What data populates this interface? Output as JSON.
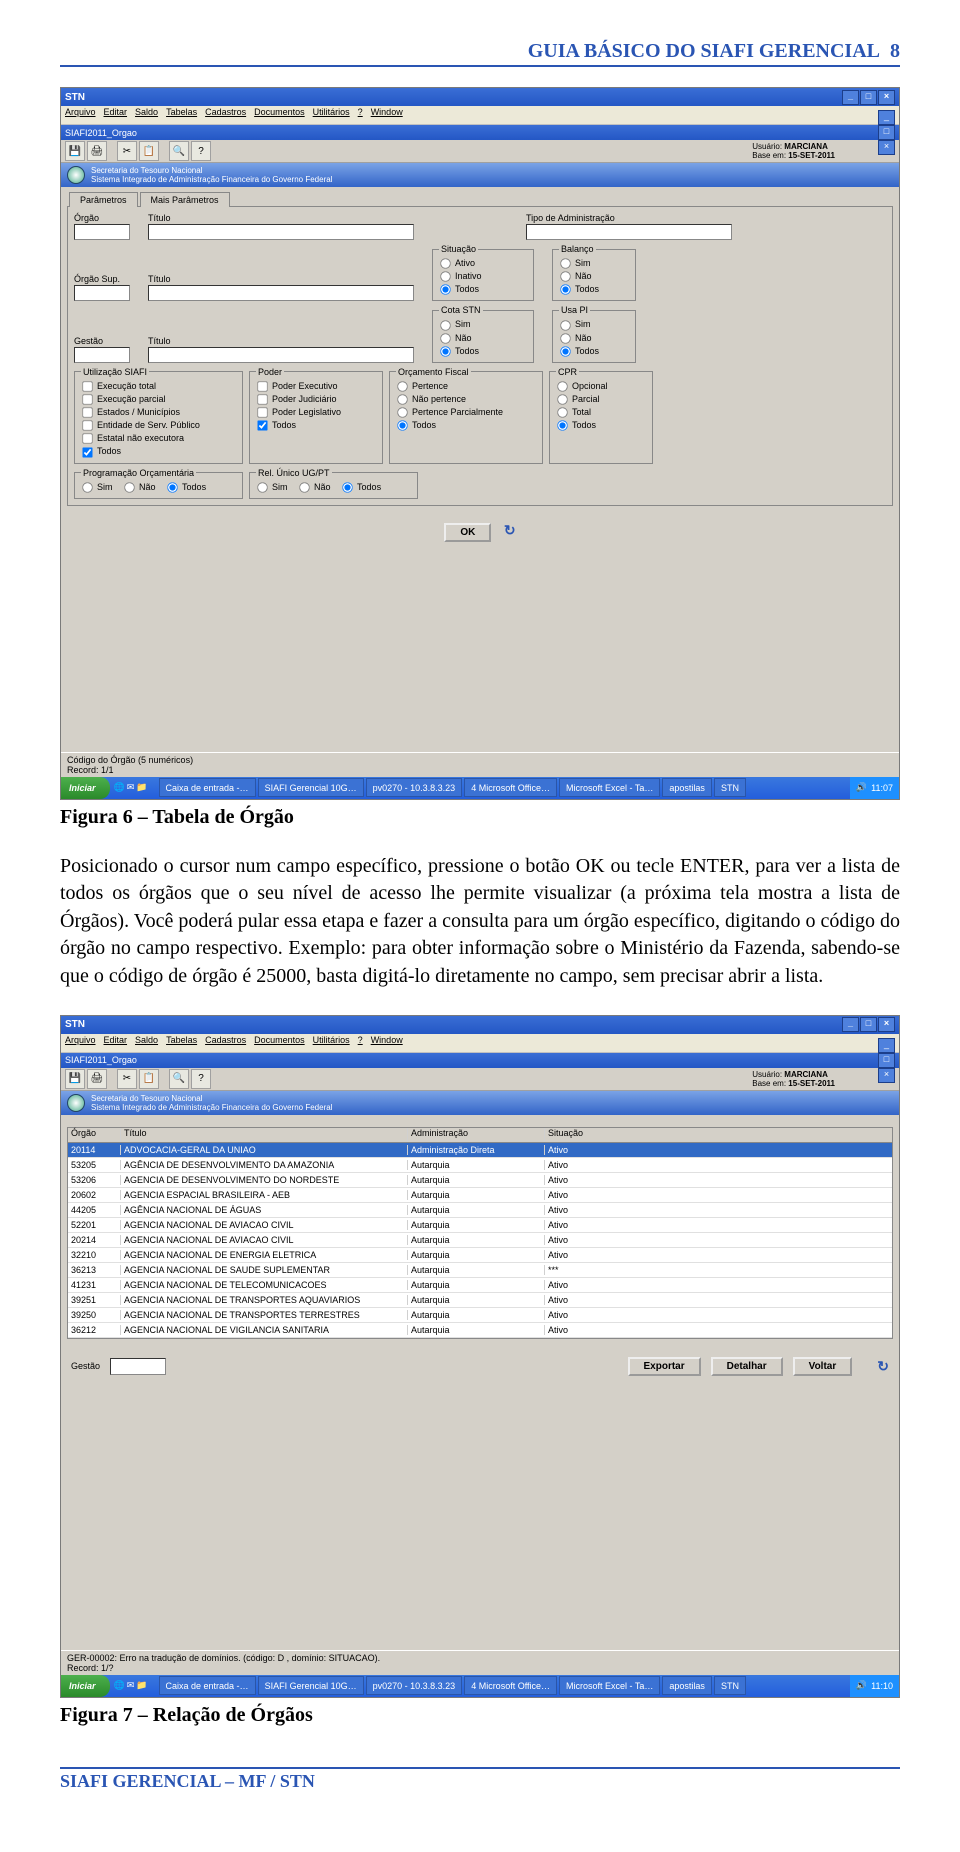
{
  "page": {
    "header": "GUIA BÁSICO DO SIAFI GERENCIAL",
    "page_number": "8",
    "footer": "SIAFI GERENCIAL – MF / STN"
  },
  "fig1": {
    "caption": "Figura 6 – Tabela de Órgão",
    "window_title": "STN",
    "menu": [
      "Arquivo",
      "Editar",
      "Saldo",
      "Tabelas",
      "Cadastros",
      "Documentos",
      "Utilitários",
      "?",
      "Window"
    ],
    "subwindow_title": "SIAFI2011_Orgao",
    "user_label": "Usuário:",
    "user_value": "MARCIANA",
    "base_label": "Base em:",
    "base_value": "15-SET-2011",
    "band_line1": "Secretaria do Tesouro Nacional",
    "band_line2": "Sistema Integrado de Administração Financeira do Governo Federal",
    "tabs": {
      "a": "Parâmetros",
      "b": "Mais Parâmetros"
    },
    "labels": {
      "orgao": "Órgão",
      "titulo": "Título",
      "tipo_admin": "Tipo de Administração",
      "orgao_sup": "Órgão Sup.",
      "gestao": "Gestão",
      "situacao": "Situação",
      "balanco": "Balanço",
      "cota_stn": "Cota STN",
      "usa_pi": "Usa PI",
      "utilizacao_siafi": "Utilização SIAFI",
      "poder": "Poder",
      "orcamento_fiscal": "Orçamento Fiscal",
      "cpr": "CPR",
      "prog_orcamentaria": "Programação Orçamentária",
      "rel_unico": "Rel. Único UG/PT"
    },
    "opts": {
      "situacao": [
        "Ativo",
        "Inativo",
        "Todos"
      ],
      "balanco": [
        "Sim",
        "Não",
        "Todos"
      ],
      "cota_stn": [
        "Sim",
        "Não",
        "Todos"
      ],
      "usa_pi": [
        "Sim",
        "Não",
        "Todos"
      ],
      "utilizacao_siafi": [
        "Execução total",
        "Execução parcial",
        "Estados / Municípios",
        "Entidade de Serv. Público",
        "Estatal não executora",
        "Todos"
      ],
      "poder": [
        "Poder Executivo",
        "Poder Judiciário",
        "Poder Legislativo",
        "Todos"
      ],
      "orcamento_fiscal": [
        "Pertence",
        "Não pertence",
        "Pertence Parcialmente",
        "Todos"
      ],
      "cpr": [
        "Opcional",
        "Parcial",
        "Total",
        "Todos"
      ],
      "sim_nao_todos": [
        "Sim",
        "Não",
        "Todos"
      ]
    },
    "ok_button": "OK",
    "status_line1": "Código do Órgão (5 numéricos)",
    "status_line2": "Record: 1/1",
    "taskbar": {
      "start": "Iniciar",
      "items": [
        "Caixa de entrada -…",
        "SIAFI Gerencial 10G…",
        "pv0270 - 10.3.8.3.23",
        "4 Microsoft Office…",
        "Microsoft Excel - Ta…",
        "apostilas",
        "STN"
      ],
      "time": "11:07"
    }
  },
  "paragraph": "Posicionado o cursor num campo específico, pressione o botão OK ou tecle ENTER, para ver a lista de todos os órgãos que o seu nível de acesso lhe permite visualizar (a próxima tela mostra a lista de Órgãos). Você poderá pular essa etapa e fazer a consulta para um órgão específico, digitando o código do órgão no campo respectivo. Exemplo: para obter informação sobre o Ministério da Fazenda, sabendo-se que o código de órgão é 25000, basta digitá-lo diretamente no campo, sem precisar abrir a lista.",
  "fig2": {
    "caption": "Figura 7 – Relação de Órgãos",
    "window_title": "STN",
    "subwindow_title": "SIAFI2011_Orgao",
    "columns": [
      "Órgão",
      "Título",
      "Administração",
      "Situação"
    ],
    "rows": [
      {
        "orgao": "20114",
        "titulo": "ADVOCACIA-GERAL DA UNIAO",
        "admin": "Administração Direta",
        "sit": "Ativo",
        "sel": true
      },
      {
        "orgao": "53205",
        "titulo": "AGÊNCIA DE DESENVOLVIMENTO DA AMAZONIA",
        "admin": "Autarquia",
        "sit": "Ativo"
      },
      {
        "orgao": "53206",
        "titulo": "AGENCIA DE DESENVOLVIMENTO DO NORDESTE",
        "admin": "Autarquia",
        "sit": "Ativo"
      },
      {
        "orgao": "20602",
        "titulo": "AGENCIA ESPACIAL BRASILEIRA - AEB",
        "admin": "Autarquia",
        "sit": "Ativo"
      },
      {
        "orgao": "44205",
        "titulo": "AGÊNCIA NACIONAL DE ÁGUAS",
        "admin": "Autarquia",
        "sit": "Ativo"
      },
      {
        "orgao": "52201",
        "titulo": "AGENCIA NACIONAL DE AVIACAO CIVIL",
        "admin": "Autarquia",
        "sit": "Ativo"
      },
      {
        "orgao": "20214",
        "titulo": "AGENCIA NACIONAL DE AVIACAO CIVIL",
        "admin": "Autarquia",
        "sit": "Ativo"
      },
      {
        "orgao": "32210",
        "titulo": "AGENCIA NACIONAL DE ENERGIA ELETRICA",
        "admin": "Autarquia",
        "sit": "Ativo"
      },
      {
        "orgao": "36213",
        "titulo": "AGENCIA NACIONAL DE SAUDE SUPLEMENTAR",
        "admin": "Autarquia",
        "sit": "***"
      },
      {
        "orgao": "41231",
        "titulo": "AGENCIA NACIONAL DE TELECOMUNICACOES",
        "admin": "Autarquia",
        "sit": "Ativo"
      },
      {
        "orgao": "39251",
        "titulo": "AGENCIA NACIONAL DE TRANSPORTES AQUAVIARIOS",
        "admin": "Autarquia",
        "sit": "Ativo"
      },
      {
        "orgao": "39250",
        "titulo": "AGENCIA NACIONAL DE TRANSPORTES TERRESTRES",
        "admin": "Autarquia",
        "sit": "Ativo"
      },
      {
        "orgao": "36212",
        "titulo": "AGENCIA NACIONAL DE VIGILANCIA SANITARIA",
        "admin": "Autarquia",
        "sit": "Ativo"
      }
    ],
    "bottom_left_label": "Gestão",
    "buttons": [
      "Exportar",
      "Detalhar",
      "Voltar"
    ],
    "status_line1": "GER-00002: Erro na tradução de domínios. (código: D , domínio: SITUACAO).",
    "status_line2": "Record: 1/?",
    "taskbar": {
      "start": "Iniciar",
      "items": [
        "Caixa de entrada -…",
        "SIAFI Gerencial 10G…",
        "pv0270 - 10.3.8.3.23",
        "4 Microsoft Office…",
        "Microsoft Excel - Ta…",
        "apostilas",
        "STN"
      ],
      "time": "11:10"
    }
  }
}
